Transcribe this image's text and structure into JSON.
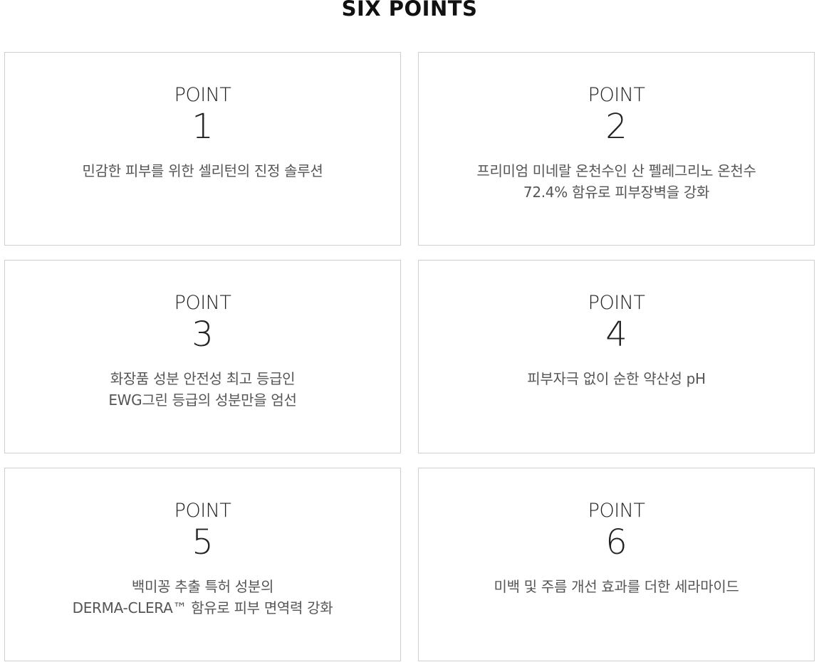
{
  "section": {
    "title": "SIX POINTS"
  },
  "points": [
    {
      "kicker": "POINT",
      "number": "1",
      "lines": [
        "민감한 피부를 위한 셀리턴의 진정 솔루션"
      ]
    },
    {
      "kicker": "POINT",
      "number": "2",
      "lines": [
        "프리미엄 미네랄 온천수인 산 펠레그리노 온천수",
        "72.4% 함유로 피부장벽을 강화"
      ]
    },
    {
      "kicker": "POINT",
      "number": "3",
      "lines": [
        "화장품 성분 안전성 최고 등급인",
        "EWG그린 등급의 성분만을 엄선"
      ]
    },
    {
      "kicker": "POINT",
      "number": "4",
      "lines": [
        "피부자극 없이 순한 약산성 pH"
      ]
    },
    {
      "kicker": "POINT",
      "number": "5",
      "lines": [
        "백미꽁 추출 특허 성분의",
        "DERMA-CLERA™ 함유로 피부 면역력 강화"
      ]
    },
    {
      "kicker": "POINT",
      "number": "6",
      "lines": [
        "미백 및 주름 개선 효과를 더한 세라마이드"
      ]
    }
  ]
}
